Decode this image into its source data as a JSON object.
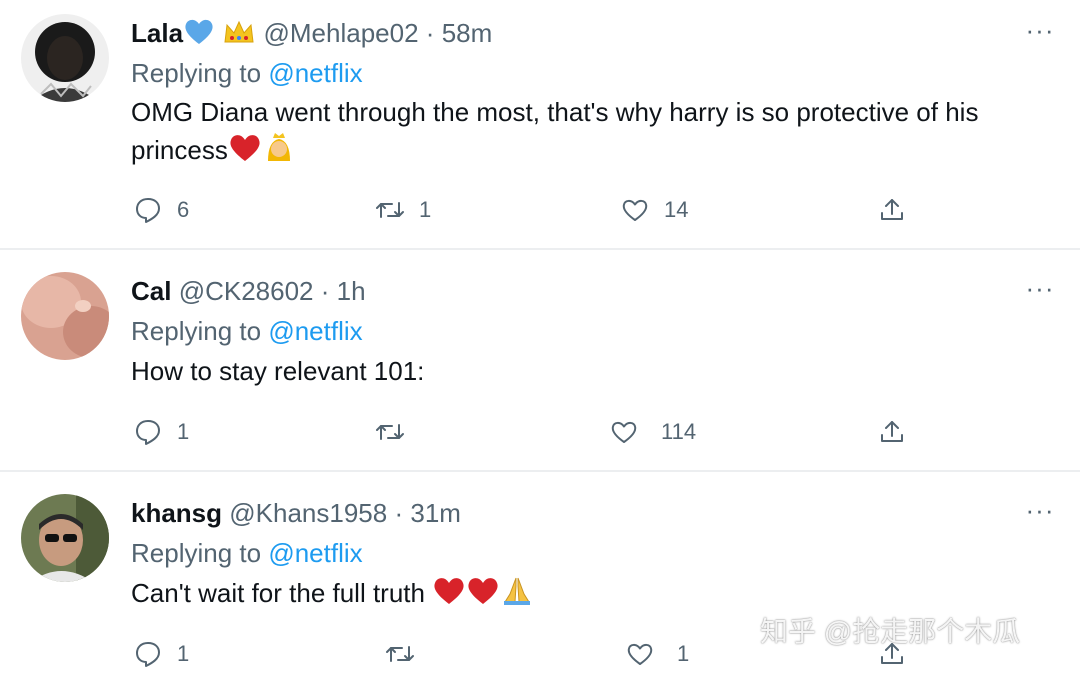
{
  "tweets": [
    {
      "name": "Lala",
      "handle": "@Mehlape02",
      "sep": "·",
      "time": "58m",
      "replying_prefix": "Replying to ",
      "replying_to": "@netflix",
      "text_line1": "OMG Diana went through the most, that's why harry is so protective of his",
      "text_line2": "princess",
      "replies": "6",
      "retweets": "1",
      "likes": "14",
      "more": "···"
    },
    {
      "name": "Cal",
      "handle": "@CK28602",
      "sep": "·",
      "time": "1h",
      "replying_prefix": "Replying to ",
      "replying_to": "@netflix",
      "text_line1": "How to stay relevant 101:",
      "replies": "1",
      "retweets": "",
      "likes": "114",
      "more": "···"
    },
    {
      "name": "khansg",
      "handle": "@Khans1958",
      "sep": "·",
      "time": "31m",
      "replying_prefix": "Replying to ",
      "replying_to": "@netflix",
      "text_line1": "Can't wait for the full truth",
      "replies": "1",
      "retweets": "",
      "likes": "1",
      "more": "···"
    }
  ],
  "watermark": "知乎 @抢走那个木瓜",
  "colors": {
    "link": "#1d9bf0",
    "muted": "#536471",
    "text": "#0f1419",
    "heart": "#d8232a",
    "divider": "#eceef0"
  }
}
